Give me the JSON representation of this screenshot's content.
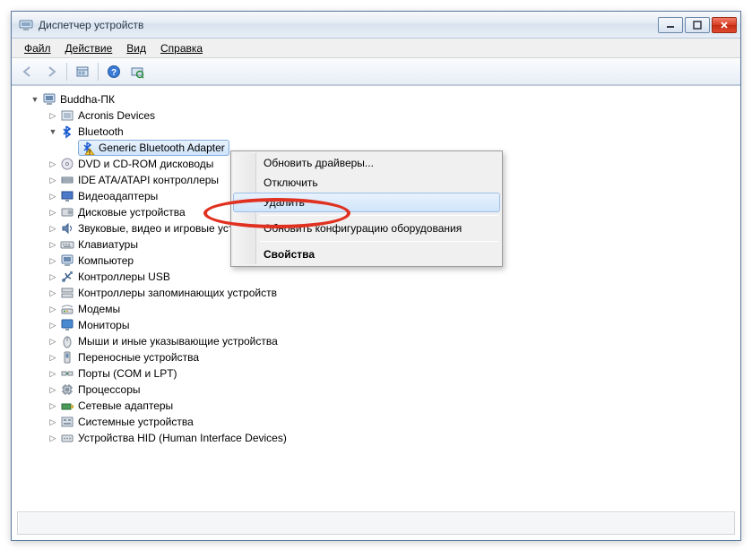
{
  "window": {
    "title": "Диспетчер устройств"
  },
  "menubar": {
    "file": "Файл",
    "action": "Действие",
    "view": "Вид",
    "help": "Справка"
  },
  "tree": {
    "root": "Buddha-ПК",
    "nodes": [
      {
        "label": "Acronis Devices",
        "expanded": false,
        "icon": "generic-device"
      },
      {
        "label": "Bluetooth",
        "expanded": true,
        "icon": "bluetooth",
        "children": [
          {
            "label": "Generic Bluetooth Adapter",
            "icon": "bluetooth-adapter-warning",
            "selected": true
          }
        ]
      },
      {
        "label": "DVD и CD-ROM дисководы",
        "expanded": false,
        "icon": "optical-drive"
      },
      {
        "label": "IDE ATA/ATAPI контроллеры",
        "expanded": false,
        "icon": "ide-controller"
      },
      {
        "label": "Видеоадаптеры",
        "expanded": false,
        "icon": "display-adapter"
      },
      {
        "label": "Дисковые устройства",
        "expanded": false,
        "icon": "disk-drive"
      },
      {
        "label": "Звуковые, видео и игровые устройства",
        "expanded": false,
        "icon": "sound-device"
      },
      {
        "label": "Клавиатуры",
        "expanded": false,
        "icon": "keyboard"
      },
      {
        "label": "Компьютер",
        "expanded": false,
        "icon": "computer"
      },
      {
        "label": "Контроллеры USB",
        "expanded": false,
        "icon": "usb-controller"
      },
      {
        "label": "Контроллеры запоминающих устройств",
        "expanded": false,
        "icon": "storage-controller"
      },
      {
        "label": "Модемы",
        "expanded": false,
        "icon": "modem"
      },
      {
        "label": "Мониторы",
        "expanded": false,
        "icon": "monitor"
      },
      {
        "label": "Мыши и иные указывающие устройства",
        "expanded": false,
        "icon": "mouse"
      },
      {
        "label": "Переносные устройства",
        "expanded": false,
        "icon": "portable-device"
      },
      {
        "label": "Порты (COM и LPT)",
        "expanded": false,
        "icon": "port"
      },
      {
        "label": "Процессоры",
        "expanded": false,
        "icon": "processor"
      },
      {
        "label": "Сетевые адаптеры",
        "expanded": false,
        "icon": "network-adapter"
      },
      {
        "label": "Системные устройства",
        "expanded": false,
        "icon": "system-device"
      },
      {
        "label": "Устройства HID (Human Interface Devices)",
        "expanded": false,
        "icon": "hid-device"
      }
    ]
  },
  "context_menu": {
    "update_drivers": "Обновить драйверы...",
    "disable": "Отключить",
    "uninstall": "Удалить",
    "scan_hardware": "Обновить конфигурацию оборудования",
    "properties": "Свойства"
  },
  "icons": {
    "minimize": "–",
    "maximize": "□",
    "close": "✕",
    "tri_collapsed": "▷",
    "tri_expanded": "▼"
  }
}
